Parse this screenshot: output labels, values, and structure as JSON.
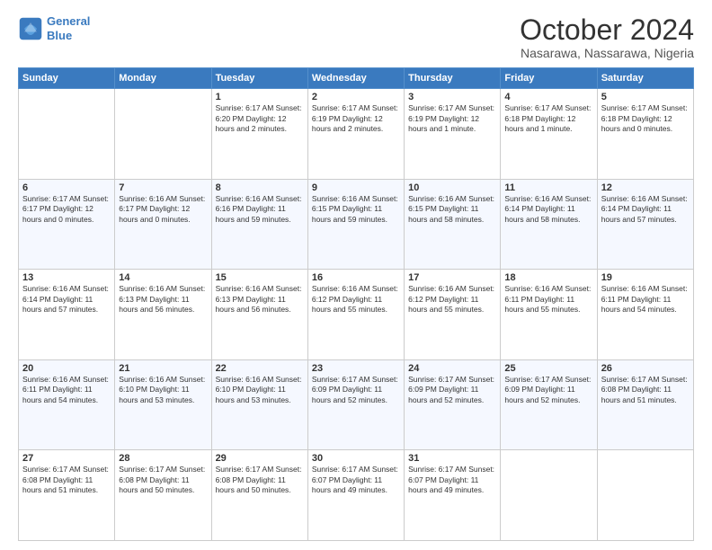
{
  "header": {
    "logo_line1": "General",
    "logo_line2": "Blue",
    "title": "October 2024",
    "subtitle": "Nasarawa, Nassarawa, Nigeria"
  },
  "days_of_week": [
    "Sunday",
    "Monday",
    "Tuesday",
    "Wednesday",
    "Thursday",
    "Friday",
    "Saturday"
  ],
  "weeks": [
    [
      {
        "day": "",
        "info": ""
      },
      {
        "day": "",
        "info": ""
      },
      {
        "day": "1",
        "info": "Sunrise: 6:17 AM\nSunset: 6:20 PM\nDaylight: 12 hours and 2 minutes."
      },
      {
        "day": "2",
        "info": "Sunrise: 6:17 AM\nSunset: 6:19 PM\nDaylight: 12 hours and 2 minutes."
      },
      {
        "day": "3",
        "info": "Sunrise: 6:17 AM\nSunset: 6:19 PM\nDaylight: 12 hours and 1 minute."
      },
      {
        "day": "4",
        "info": "Sunrise: 6:17 AM\nSunset: 6:18 PM\nDaylight: 12 hours and 1 minute."
      },
      {
        "day": "5",
        "info": "Sunrise: 6:17 AM\nSunset: 6:18 PM\nDaylight: 12 hours and 0 minutes."
      }
    ],
    [
      {
        "day": "6",
        "info": "Sunrise: 6:17 AM\nSunset: 6:17 PM\nDaylight: 12 hours and 0 minutes."
      },
      {
        "day": "7",
        "info": "Sunrise: 6:16 AM\nSunset: 6:17 PM\nDaylight: 12 hours and 0 minutes."
      },
      {
        "day": "8",
        "info": "Sunrise: 6:16 AM\nSunset: 6:16 PM\nDaylight: 11 hours and 59 minutes."
      },
      {
        "day": "9",
        "info": "Sunrise: 6:16 AM\nSunset: 6:15 PM\nDaylight: 11 hours and 59 minutes."
      },
      {
        "day": "10",
        "info": "Sunrise: 6:16 AM\nSunset: 6:15 PM\nDaylight: 11 hours and 58 minutes."
      },
      {
        "day": "11",
        "info": "Sunrise: 6:16 AM\nSunset: 6:14 PM\nDaylight: 11 hours and 58 minutes."
      },
      {
        "day": "12",
        "info": "Sunrise: 6:16 AM\nSunset: 6:14 PM\nDaylight: 11 hours and 57 minutes."
      }
    ],
    [
      {
        "day": "13",
        "info": "Sunrise: 6:16 AM\nSunset: 6:14 PM\nDaylight: 11 hours and 57 minutes."
      },
      {
        "day": "14",
        "info": "Sunrise: 6:16 AM\nSunset: 6:13 PM\nDaylight: 11 hours and 56 minutes."
      },
      {
        "day": "15",
        "info": "Sunrise: 6:16 AM\nSunset: 6:13 PM\nDaylight: 11 hours and 56 minutes."
      },
      {
        "day": "16",
        "info": "Sunrise: 6:16 AM\nSunset: 6:12 PM\nDaylight: 11 hours and 55 minutes."
      },
      {
        "day": "17",
        "info": "Sunrise: 6:16 AM\nSunset: 6:12 PM\nDaylight: 11 hours and 55 minutes."
      },
      {
        "day": "18",
        "info": "Sunrise: 6:16 AM\nSunset: 6:11 PM\nDaylight: 11 hours and 55 minutes."
      },
      {
        "day": "19",
        "info": "Sunrise: 6:16 AM\nSunset: 6:11 PM\nDaylight: 11 hours and 54 minutes."
      }
    ],
    [
      {
        "day": "20",
        "info": "Sunrise: 6:16 AM\nSunset: 6:11 PM\nDaylight: 11 hours and 54 minutes."
      },
      {
        "day": "21",
        "info": "Sunrise: 6:16 AM\nSunset: 6:10 PM\nDaylight: 11 hours and 53 minutes."
      },
      {
        "day": "22",
        "info": "Sunrise: 6:16 AM\nSunset: 6:10 PM\nDaylight: 11 hours and 53 minutes."
      },
      {
        "day": "23",
        "info": "Sunrise: 6:17 AM\nSunset: 6:09 PM\nDaylight: 11 hours and 52 minutes."
      },
      {
        "day": "24",
        "info": "Sunrise: 6:17 AM\nSunset: 6:09 PM\nDaylight: 11 hours and 52 minutes."
      },
      {
        "day": "25",
        "info": "Sunrise: 6:17 AM\nSunset: 6:09 PM\nDaylight: 11 hours and 52 minutes."
      },
      {
        "day": "26",
        "info": "Sunrise: 6:17 AM\nSunset: 6:08 PM\nDaylight: 11 hours and 51 minutes."
      }
    ],
    [
      {
        "day": "27",
        "info": "Sunrise: 6:17 AM\nSunset: 6:08 PM\nDaylight: 11 hours and 51 minutes."
      },
      {
        "day": "28",
        "info": "Sunrise: 6:17 AM\nSunset: 6:08 PM\nDaylight: 11 hours and 50 minutes."
      },
      {
        "day": "29",
        "info": "Sunrise: 6:17 AM\nSunset: 6:08 PM\nDaylight: 11 hours and 50 minutes."
      },
      {
        "day": "30",
        "info": "Sunrise: 6:17 AM\nSunset: 6:07 PM\nDaylight: 11 hours and 49 minutes."
      },
      {
        "day": "31",
        "info": "Sunrise: 6:17 AM\nSunset: 6:07 PM\nDaylight: 11 hours and 49 minutes."
      },
      {
        "day": "",
        "info": ""
      },
      {
        "day": "",
        "info": ""
      }
    ]
  ]
}
